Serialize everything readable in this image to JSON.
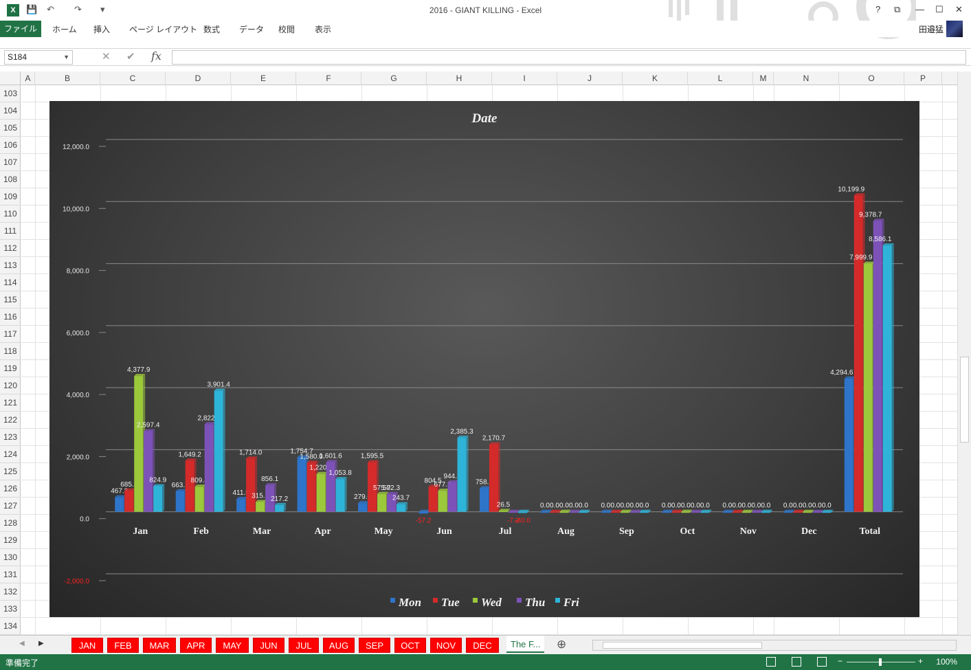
{
  "window": {
    "title": "2016 - GIANT KILLING - Excel",
    "help": "?",
    "restore": "⧉",
    "minimize": "—",
    "maximize": "☐",
    "close": "✕"
  },
  "qat": {
    "save": "💾",
    "undo": "↶",
    "redo": "↷",
    "more": "▾"
  },
  "ribbon": {
    "file": "ファイル",
    "tabs": [
      "ホーム",
      "挿入",
      "ページ レイアウト",
      "数式",
      "データ",
      "校閲",
      "表示"
    ],
    "user": "田邉猛"
  },
  "formula_bar": {
    "name_box": "S184",
    "cancel": "✕",
    "enter": "✔",
    "fx": "fx",
    "value": ""
  },
  "columns": [
    "A",
    "B",
    "C",
    "D",
    "E",
    "F",
    "G",
    "H",
    "I",
    "J",
    "K",
    "L",
    "M",
    "N",
    "O",
    "P"
  ],
  "rows": [
    "103",
    "104",
    "105",
    "106",
    "107",
    "108",
    "109",
    "110",
    "111",
    "112",
    "113",
    "114",
    "115",
    "116",
    "117",
    "118",
    "119",
    "120",
    "121",
    "122",
    "123",
    "124",
    "125",
    "126",
    "127",
    "128",
    "129",
    "130",
    "131",
    "132",
    "133",
    "134"
  ],
  "sheet_tabs": [
    "JAN",
    "FEB",
    "MAR",
    "APR",
    "MAY",
    "JUN",
    "JUL",
    "AUG",
    "SEP",
    "OCT",
    "NOV",
    "DEC"
  ],
  "active_sheet": "The F...",
  "add_sheet": "⊕",
  "status": {
    "ready": "準備完了",
    "zoom": "100%",
    "zoom_minus": "−",
    "zoom_plus": "+"
  },
  "colors": {
    "excel_green": "#217346",
    "sheet_tab_red": "#ff0000",
    "negative_label": "#ff2020"
  },
  "chart_data": {
    "type": "bar",
    "title": "Date",
    "categories": [
      "Jan",
      "Feb",
      "Mar",
      "Apr",
      "May",
      "Jun",
      "Jul",
      "Aug",
      "Sep",
      "Oct",
      "Nov",
      "Dec",
      "Total"
    ],
    "ylim": [
      -2000,
      12000
    ],
    "yticks": [
      -2000,
      0,
      2000,
      4000,
      6000,
      8000,
      10000,
      12000
    ],
    "ytick_labels": [
      "-2,000.0",
      "0.0",
      "2,000.0",
      "4,000.0",
      "6,000.0",
      "8,000.0",
      "10,000.0",
      "12,000.0"
    ],
    "grid": true,
    "legend_position": "bottom",
    "series": [
      {
        "name": "Mon",
        "color": "#2e74c9",
        "values": [
          467.3,
          663.2,
          411.5,
          1754.7,
          279.0,
          -57.2,
          758.6,
          0,
          0,
          0,
          0,
          0,
          4294.6
        ],
        "labels": [
          "467.3",
          "663.2",
          "411.5",
          "1,754.7",
          "279.0",
          "-57.2",
          "758.6",
          "0.0",
          "0.0",
          "0.0",
          "0.0",
          "0.0",
          "4,294.6"
        ]
      },
      {
        "name": "Tue",
        "color": "#d42a2a",
        "values": [
          685.3,
          1649.2,
          1714.0,
          1580.0,
          1595.5,
          804.5,
          2170.7,
          0,
          0,
          0,
          0,
          0,
          10199.9
        ],
        "labels": [
          "685.3",
          "1,649.2",
          "1,714.0",
          "1,580.0",
          "1,595.5",
          "804.5",
          "2,170.7",
          "0.0",
          "0.0",
          "0.0",
          "0.0",
          "0.0",
          "10,199.9"
        ]
      },
      {
        "name": "Wed",
        "color": "#9cc83c",
        "values": [
          4377.9,
          809.4,
          315.1,
          1220.4,
          575.0,
          677.9,
          26.5,
          0,
          0,
          0,
          0,
          0,
          7999.9
        ],
        "labels": [
          "4,377.9",
          "809.4",
          "315.1",
          "1,220.4",
          "575.0",
          "677.9",
          "26.5",
          "0.0",
          "0.0",
          "0.0",
          "0.0",
          "0.0",
          "7,999.9"
        ]
      },
      {
        "name": "Thu",
        "color": "#7d52b8",
        "values": [
          2597.4,
          2822.6,
          856.1,
          1601.6,
          572.3,
          944.9,
          -7.2,
          0,
          0,
          0,
          0,
          0,
          9378.7
        ],
        "labels": [
          "2,597.4",
          "2,822.6",
          "856.1",
          "1,601.6",
          "572.3",
          "944.9",
          "-7.2",
          "0.0",
          "0.0",
          "0.0",
          "0.0",
          "0.0",
          "9,378.7"
        ]
      },
      {
        "name": "Fri",
        "color": "#2eb4d8",
        "values": [
          824.9,
          3901.4,
          217.2,
          1053.8,
          243.7,
          2385.3,
          -40.0,
          0,
          0,
          0,
          0,
          0,
          8586.1
        ],
        "labels": [
          "824.9",
          "3,901.4",
          "217.2",
          "1,053.8",
          "243.7",
          "2,385.3",
          "-40.0",
          "0.0",
          "0.0",
          "0.0",
          "0.0",
          "0.0",
          "8,586.1"
        ]
      }
    ]
  }
}
